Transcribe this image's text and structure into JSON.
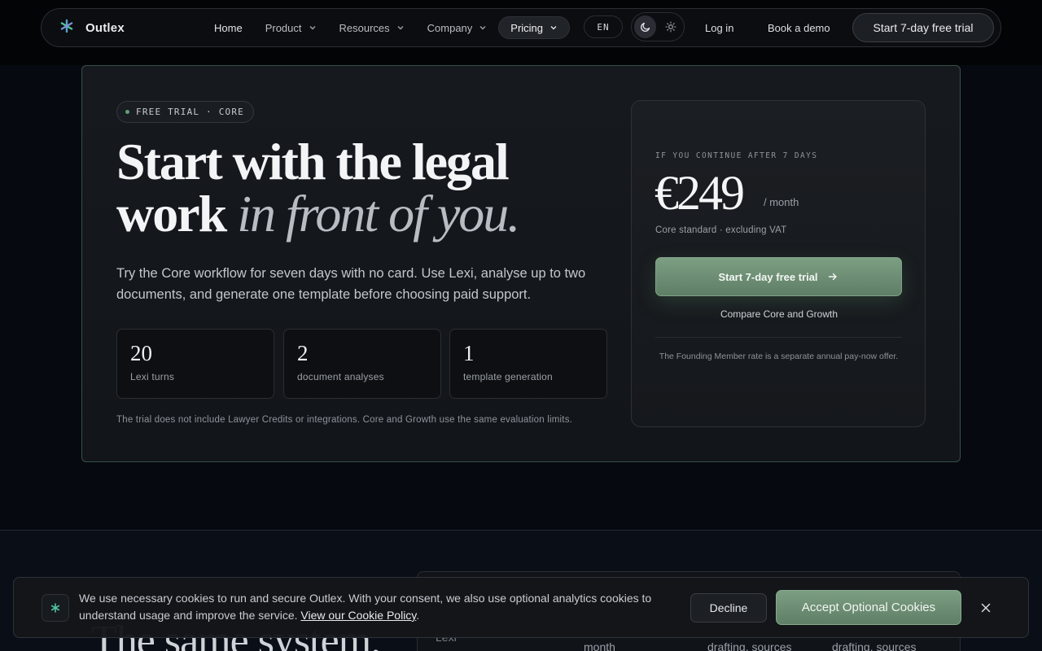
{
  "nav": {
    "brand": "Outlex",
    "links": [
      {
        "label": "Home"
      },
      {
        "label": "Product"
      },
      {
        "label": "Resources"
      },
      {
        "label": "Company"
      },
      {
        "label": "Pricing"
      }
    ],
    "language": "EN",
    "login": "Log in",
    "book_demo": "Book a demo",
    "trial_cta": "Start 7-day free trial",
    "icons": [
      "logo-asterisk-icon",
      "chevron-down-icon",
      "moon-icon",
      "sun-icon"
    ]
  },
  "hero": {
    "badge": "FREE TRIAL · CORE",
    "headline_line1": "Start with the legal",
    "headline_word": "work",
    "headline_italic": "in front of you.",
    "lead": "Try the Core workflow for seven days with no card. Use Lexi, analyse up to two documents, and generate one template before choosing paid support.",
    "stats": [
      {
        "value": "20",
        "label": "Lexi turns"
      },
      {
        "value": "2",
        "label": "document analyses"
      },
      {
        "value": "1",
        "label": "template generation"
      }
    ],
    "fine_print": "The trial does not include Lawyer Credits or integrations. Core and Growth use the same evaluation limits."
  },
  "pricing": {
    "kicker": "IF YOU CONTINUE AFTER 7 DAYS",
    "amount": "€249",
    "period": "/ month",
    "note": "Core standard · excluding VAT",
    "cta": "Start 7-day free trial",
    "compare": "Compare Core and Growth",
    "founding_note": "The Founding Member rate is a separate annual pay-now offer."
  },
  "section2": {
    "heading_fragment": "The same system.",
    "row_label": "Lexi",
    "cells": [
      "month",
      "drafting, sources",
      "drafting, sources"
    ]
  },
  "cookie": {
    "text": "We use necessary cookies to run and secure Outlex. With your consent, we also use optional analytics cookies to understand usage and improve the service.",
    "link": "View our Cookie Policy",
    "period": ".",
    "decline": "Decline",
    "accept": "Accept Optional Cookies"
  },
  "colors": {
    "accent_green": "#7c9e82",
    "background": "#06090f",
    "card_border": "#36504a"
  }
}
